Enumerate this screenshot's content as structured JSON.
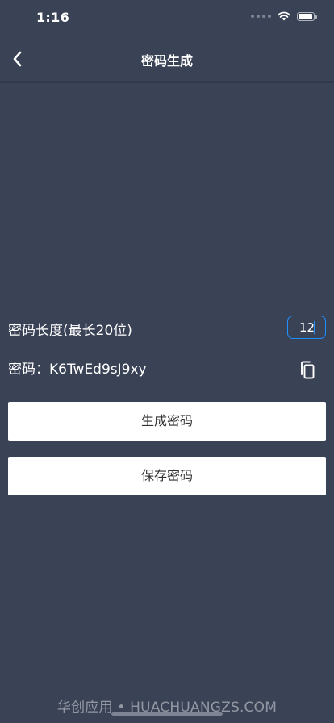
{
  "status_bar": {
    "time": "1:16",
    "icons": [
      "cellular-signal-icon",
      "wifi-icon",
      "battery-icon"
    ]
  },
  "nav": {
    "title": "密码生成",
    "back_icon": "chevron-left-icon"
  },
  "length": {
    "label": "密码长度(最长20位)",
    "value": "12"
  },
  "password": {
    "label": "密码：K6TwEd9sJ9xy",
    "copy_icon": "copy-icon"
  },
  "buttons": {
    "generate_label": "生成密码",
    "save_label": "保存密码"
  },
  "watermark": {
    "text": "华创应用 • HUACHUANGZS.COM"
  },
  "colors": {
    "background": "#3a4256",
    "accent": "#1e90ff",
    "button_background": "#ffffff",
    "button_text": "#333333"
  }
}
